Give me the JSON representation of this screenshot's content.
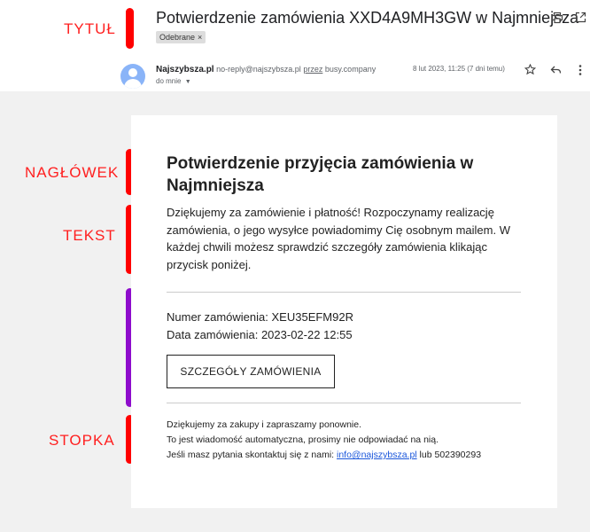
{
  "annotations": {
    "title": "TYTUŁ",
    "header": "NAGŁÓWEK",
    "text": "TEKST",
    "footer": "STOPKA",
    "colors": {
      "label": "#ff1f1f",
      "bar_red": "#ff0000",
      "bar_purple": "#8e0ccc"
    }
  },
  "email": {
    "subject": "Potwierdzenie zamówienia XXD4A9MH3GW w Najmniejsza",
    "label_chip": "Odebrane",
    "chip_close": "×",
    "sender_name": "Najszybsza.pl",
    "sender_address": "no-reply@najszybsza.pl",
    "via_word": "przez",
    "via_domain": "busy.company",
    "recipient": "do mnie",
    "date": "8 lut 2023, 11:25 (7 dni temu)",
    "icons": {
      "print": "printer-icon",
      "popout": "open-in-new-icon",
      "star": "star-icon",
      "reply": "reply-icon",
      "more": "more-vert-icon"
    }
  },
  "message": {
    "heading": "Potwierdzenie przyjęcia zamówienia w Najmniejsza",
    "body": "Dziękujemy za zamówienie i płatność! Rozpoczynamy realizację zamówienia, o jego wysyłce powiadomimy Cię osobnym mailem. W każdej chwili możesz sprawdzić szczegóły zamówienia klikając przycisk poniżej.",
    "order_number_label": "Numer zamówienia:",
    "order_number": "XEU35EFM92R",
    "order_date_label": "Data zamówienia:",
    "order_date": "2023-02-22 12:55",
    "button_label": "SZCZEGÓŁY ZAMÓWIENIA",
    "footer_line1": "Dziękujemy za zakupy i zapraszamy ponownie.",
    "footer_line2": "To jest wiadomość automatyczna, prosimy nie odpowiadać na nią.",
    "footer_line3_prefix": "Jeśli masz pytania skontaktuj się z nami:",
    "footer_email": "info@najszybsza.pl",
    "footer_line3_suffix": "lub 502390293"
  }
}
